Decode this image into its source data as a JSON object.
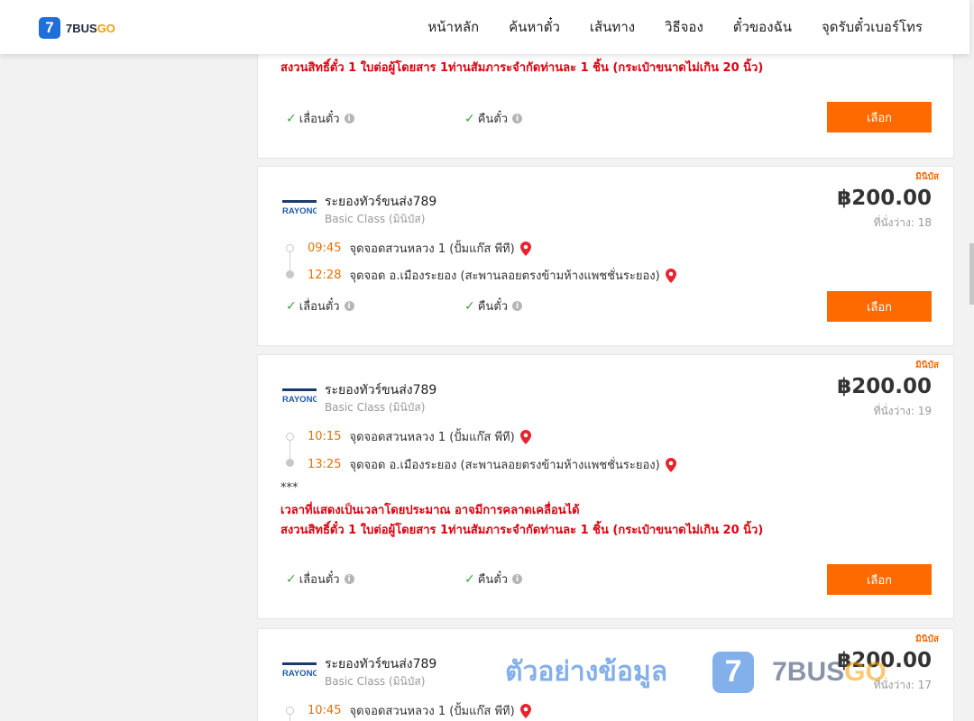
{
  "header": {
    "logo_mark": "7",
    "logo_text_main": "7BUS",
    "logo_text_accent": "GO",
    "nav": [
      "หน้าหลัก",
      "ค้นหาตั๋ว",
      "เส้นทาง",
      "วิธีจอง",
      "ตั๋วของฉัน",
      "จุดรับตั๋วเบอร์โทร"
    ]
  },
  "top_card": {
    "warning": "สงวนสิทธิ์ตั๋ว 1 ใบต่อผู้โดยสาร 1ท่านสัมภาระจำกัดท่านละ 1 ชิ้น (กระเป๋าขนาดไม่เกิน 20 นิ้ว)",
    "feature_reschedule": "เลื่อนตั๋ว",
    "feature_refund": "คืนตั๋ว",
    "select_label": "เลือก"
  },
  "trips": [
    {
      "badge": "มินิบัส",
      "operator_logo_text": "RAYONG",
      "operator": "ระยองทัวร์ขนส่ง789",
      "class": "Basic Class (มินิบัส)",
      "price": "฿200.00",
      "seats": "ที่นั่งว่าง: 18",
      "depart_time": "09:45",
      "depart_place": "จุดจอดสวนหลวง 1 (ปั้มแก๊ส พีที)",
      "arrive_time": "12:28",
      "arrive_place": "จุดจอด อ.เมืองระยอง (สะพานลอยตรงข้ามห้างแพชชั่นระยอง)",
      "feature_reschedule": "เลื่อนตั๋ว",
      "feature_refund": "คืนตั๋ว",
      "select_label": "เลือก"
    },
    {
      "badge": "มินิบัส",
      "operator_logo_text": "RAYONG",
      "operator": "ระยองทัวร์ขนส่ง789",
      "class": "Basic Class (มินิบัส)",
      "price": "฿200.00",
      "seats": "ที่นั่งว่าง: 19",
      "depart_time": "10:15",
      "depart_place": "จุดจอดสวนหลวง 1 (ปั้มแก๊ส พีที)",
      "arrive_time": "13:25",
      "arrive_place": "จุดจอด อ.เมืองระยอง (สะพานลอยตรงข้ามห้างแพชชั่นระยอง)",
      "note": "***",
      "warning_1": "เวลาที่แสดงเป็นเวลาโดยประมาณ อาจมีการคลาดเคลื่อนได้",
      "warning_2": "สงวนสิทธิ์ตั๋ว 1 ใบต่อผู้โดยสาร 1ท่านสัมภาระจำกัดท่านละ 1 ชิ้น (กระเป๋าขนาดไม่เกิน 20 นิ้ว)",
      "feature_reschedule": "เลื่อนตั๋ว",
      "feature_refund": "คืนตั๋ว",
      "select_label": "เลือก"
    },
    {
      "badge": "มินิบัส",
      "operator_logo_text": "RAYONG",
      "operator": "ระยองทัวร์ขนส่ง789",
      "class": "Basic Class (มินิบัส)",
      "price": "฿200.00",
      "seats": "ที่นั่งว่าง: 17",
      "depart_time": "10:45",
      "depart_place": "จุดจอดสวนหลวง 1 (ปั้มแก๊ส พีที)"
    }
  ],
  "watermark": {
    "text": "ตัวอย่างข้อมูล",
    "logo_mark": "7",
    "brand_main": "7BUS",
    "brand_accent": "GO"
  },
  "colors": {
    "accent": "#ff6a00",
    "brand_blue": "#1e6fd9",
    "warning_red": "#e0000e",
    "time_orange": "#e6700a",
    "check_green": "#3aa53a"
  }
}
